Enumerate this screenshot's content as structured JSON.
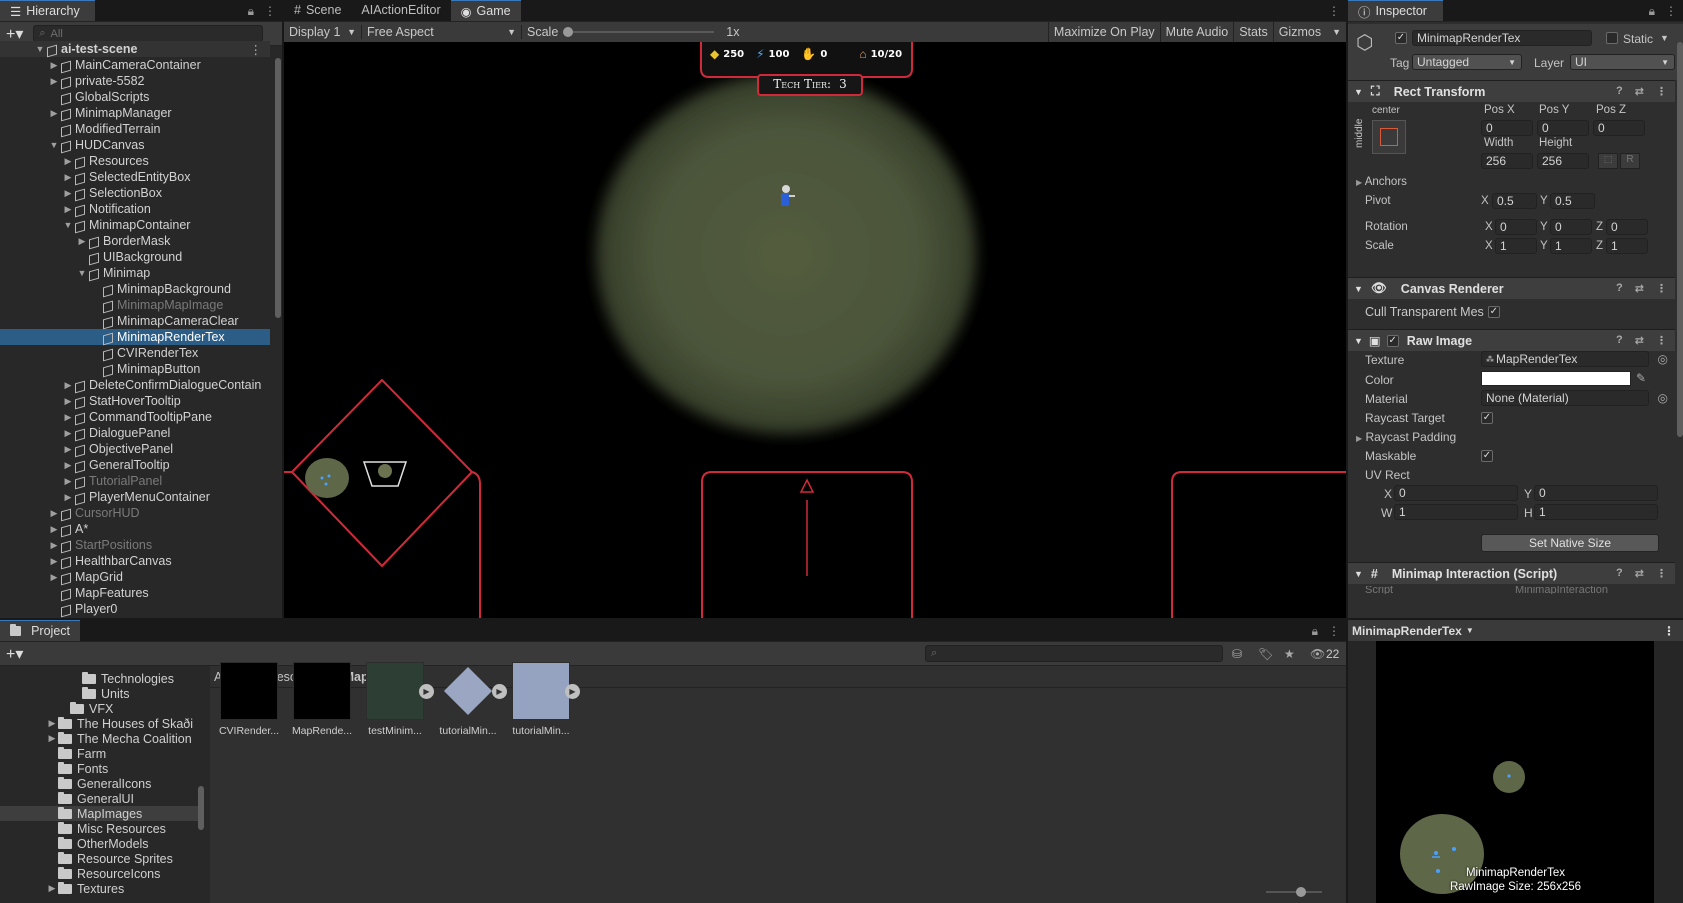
{
  "hierarchy": {
    "title": "Hierarchy",
    "search_placeholder": "All",
    "rows": [
      {
        "label": "ai-test-scene",
        "depth": 0,
        "arrow": "▼",
        "bold": true
      },
      {
        "label": "MainCameraContainer",
        "depth": 1,
        "arrow": "▶"
      },
      {
        "label": "private-5582",
        "depth": 1,
        "arrow": "▶"
      },
      {
        "label": "GlobalScripts",
        "depth": 1,
        "arrow": ""
      },
      {
        "label": "MinimapManager",
        "depth": 1,
        "arrow": "▶"
      },
      {
        "label": "ModifiedTerrain",
        "depth": 1,
        "arrow": ""
      },
      {
        "label": "HUDCanvas",
        "depth": 1,
        "arrow": "▼"
      },
      {
        "label": "Resources",
        "depth": 2,
        "arrow": "▶"
      },
      {
        "label": "SelectedEntityBox",
        "depth": 2,
        "arrow": "▶"
      },
      {
        "label": "SelectionBox",
        "depth": 2,
        "arrow": "▶"
      },
      {
        "label": "Notification",
        "depth": 2,
        "arrow": "▶"
      },
      {
        "label": "MinimapContainer",
        "depth": 2,
        "arrow": "▼"
      },
      {
        "label": "BorderMask",
        "depth": 3,
        "arrow": "▶"
      },
      {
        "label": "UIBackground",
        "depth": 3,
        "arrow": ""
      },
      {
        "label": "Minimap",
        "depth": 3,
        "arrow": "▼"
      },
      {
        "label": "MinimapBackground",
        "depth": 4,
        "arrow": ""
      },
      {
        "label": "MinimapMapImage",
        "depth": 4,
        "arrow": "",
        "dim": true
      },
      {
        "label": "MinimapCameraClear",
        "depth": 4,
        "arrow": ""
      },
      {
        "label": "MinimapRenderTex",
        "depth": 4,
        "arrow": "",
        "selected": true
      },
      {
        "label": "CVIRenderTex",
        "depth": 4,
        "arrow": ""
      },
      {
        "label": "MinimapButton",
        "depth": 4,
        "arrow": ""
      },
      {
        "label": "DeleteConfirmDialogueContain",
        "depth": 2,
        "arrow": "▶"
      },
      {
        "label": "StatHoverTooltip",
        "depth": 2,
        "arrow": "▶"
      },
      {
        "label": "CommandTooltipPane",
        "depth": 2,
        "arrow": "▶"
      },
      {
        "label": "DialoguePanel",
        "depth": 2,
        "arrow": "▶"
      },
      {
        "label": "ObjectivePanel",
        "depth": 2,
        "arrow": "▶"
      },
      {
        "label": "GeneralTooltip",
        "depth": 2,
        "arrow": "▶"
      },
      {
        "label": "TutorialPanel",
        "depth": 2,
        "arrow": "▶",
        "dim": true
      },
      {
        "label": "PlayerMenuContainer",
        "depth": 2,
        "arrow": "▶"
      },
      {
        "label": "CursorHUD",
        "depth": 1,
        "arrow": "▶",
        "dim": true
      },
      {
        "label": "A*",
        "depth": 1,
        "arrow": "▶"
      },
      {
        "label": "StartPositions",
        "depth": 1,
        "arrow": "▶",
        "dim": true
      },
      {
        "label": "HealthbarCanvas",
        "depth": 1,
        "arrow": "▶"
      },
      {
        "label": "MapGrid",
        "depth": 1,
        "arrow": "▶"
      },
      {
        "label": "MapFeatures",
        "depth": 1,
        "arrow": ""
      },
      {
        "label": "Player0",
        "depth": 1,
        "arrow": ""
      }
    ]
  },
  "tabs": {
    "scene": "Scene",
    "ai_action_editor": "AIActionEditor",
    "game": "Game"
  },
  "game_toolbar": {
    "display": "Display 1",
    "aspect": "Free Aspect",
    "scale_label": "Scale",
    "scale_value": "1x",
    "maximize": "Maximize On Play",
    "mute": "Mute Audio",
    "stats": "Stats",
    "gizmos": "Gizmos"
  },
  "hud": {
    "gold": "250",
    "energy": "100",
    "handshake": "0",
    "population": "10/20",
    "tech_tier_label": "Tech Tier:",
    "tech_tier_value": "3"
  },
  "inspector": {
    "title": "Inspector",
    "object_name": "MinimapRenderTex",
    "static_label": "Static",
    "tag_label": "Tag",
    "tag_value": "Untagged",
    "layer_label": "Layer",
    "layer_value": "UI",
    "rect": {
      "title": "Rect Transform",
      "anchor_h": "center",
      "anchor_v": "middle",
      "posx_label": "Pos X",
      "posy_label": "Pos Y",
      "posz_label": "Pos Z",
      "posx": "0",
      "posy": "0",
      "posz": "0",
      "width_label": "Width",
      "height_label": "Height",
      "width": "256",
      "height": "256",
      "r_label": "R",
      "anchors": "Anchors",
      "pivot": "Pivot",
      "pivot_x_label": "X",
      "pivot_x": "0.5",
      "pivot_y_label": "Y",
      "pivot_y": "0.5",
      "rotation": "Rotation",
      "rot_x": "0",
      "rot_y": "0",
      "rot_z": "0",
      "scale": "Scale",
      "scale_x": "1",
      "scale_y": "1",
      "scale_z": "1",
      "x_lbl": "X",
      "y_lbl": "Y",
      "z_lbl": "Z"
    },
    "canvas_renderer": {
      "title": "Canvas Renderer",
      "cull": "Cull Transparent Mes"
    },
    "raw_image": {
      "title": "Raw Image",
      "texture_label": "Texture",
      "texture": "MapRenderTex",
      "color_label": "Color",
      "material_label": "Material",
      "material": "None (Material)",
      "raycast_target": "Raycast Target",
      "raycast_padding": "Raycast Padding",
      "maskable": "Maskable",
      "uv_rect": "UV Rect",
      "uv_x_label": "X",
      "uv_x": "0",
      "uv_y_label": "Y",
      "uv_y": "0",
      "uv_w_label": "W",
      "uv_w": "1",
      "uv_h_label": "H",
      "uv_h": "1",
      "set_native": "Set Native Size",
      "color_value": "#ffffff"
    },
    "minimap_interaction": {
      "title": "Minimap Interaction (Script)",
      "script_label": "Script",
      "script_value": "MinimapInteraction"
    },
    "preview": {
      "dropdown": "MinimapRenderTex",
      "name": "MinimapRenderTex",
      "size": "RawImage Size: 256x256"
    }
  },
  "project": {
    "title": "Project",
    "count": "22",
    "breadcrumb": [
      "Assets",
      "Resources",
      "MapImages"
    ],
    "tree": [
      {
        "label": "Technologies",
        "depth": 3,
        "arrow": ""
      },
      {
        "label": "Units",
        "depth": 3,
        "arrow": ""
      },
      {
        "label": "VFX",
        "depth": 2,
        "arrow": ""
      },
      {
        "label": "The Houses of Skaði",
        "depth": 1,
        "arrow": "▶"
      },
      {
        "label": "The Mecha Coalition",
        "depth": 1,
        "arrow": "▶"
      },
      {
        "label": "Farm",
        "depth": 1,
        "arrow": ""
      },
      {
        "label": "Fonts",
        "depth": 1,
        "arrow": ""
      },
      {
        "label": "GeneralIcons",
        "depth": 1,
        "arrow": ""
      },
      {
        "label": "GeneralUI",
        "depth": 1,
        "arrow": ""
      },
      {
        "label": "MapImages",
        "depth": 1,
        "arrow": "",
        "selected": true
      },
      {
        "label": "Misc Resources",
        "depth": 1,
        "arrow": ""
      },
      {
        "label": "OtherModels",
        "depth": 1,
        "arrow": ""
      },
      {
        "label": "Resource Sprites",
        "depth": 1,
        "arrow": ""
      },
      {
        "label": "ResourceIcons",
        "depth": 1,
        "arrow": ""
      },
      {
        "label": "Textures",
        "depth": 1,
        "arrow": "▶"
      }
    ],
    "assets": [
      {
        "label": "CVIRender...",
        "color": "#000000",
        "shape": "square",
        "play": false
      },
      {
        "label": "MapRende...",
        "color": "#000000",
        "shape": "square",
        "play": false
      },
      {
        "label": "testMinim...",
        "color": "#2d3f35",
        "shape": "square",
        "play": true
      },
      {
        "label": "tutorialMin...",
        "color": "#9aa6c2",
        "shape": "diamond",
        "play": true
      },
      {
        "label": "tutorialMin...",
        "color": "#95a2c0",
        "shape": "square",
        "play": true
      }
    ]
  }
}
